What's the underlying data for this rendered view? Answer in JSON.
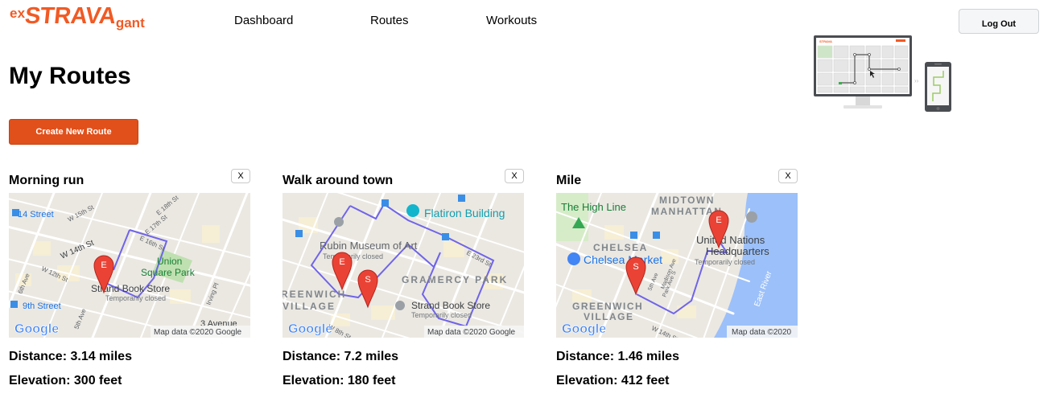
{
  "brand": {
    "ex": "ex",
    "strava": "STRAVA",
    "gant": "gant",
    "color": "#f15a24"
  },
  "nav": {
    "dashboard": "Dashboard",
    "routes": "Routes",
    "workouts": "Workouts"
  },
  "logout_label": "Log Out",
  "page_title": "My Routes",
  "create_button": "Create New Route",
  "illustration": {
    "screen_brand": "STRAVA"
  },
  "route_color": "#6f64e8",
  "marker_color": "#ea4335",
  "routes": [
    {
      "name": "Morning run",
      "close_label": "X",
      "distance": "Distance: 3.14 miles",
      "elevation": "Elevation: 300 feet",
      "map": {
        "labels": [
          "14 Street",
          "W 15th St",
          "W 14th St",
          "E 18th St",
          "E 17th St",
          "E 16th St",
          "Union",
          "Square Park",
          "Strand Book Store",
          "Temporarily closed",
          "9th Street",
          "6th Ave",
          "W 12th St",
          "5th Ave",
          "Irving Pl",
          "3 Avenue"
        ],
        "markers": [
          "E"
        ],
        "google": "Google",
        "attribution": "Map data ©2020 Google"
      }
    },
    {
      "name": "Walk around town",
      "close_label": "X",
      "distance": "Distance: 7.2 miles",
      "elevation": "Elevation: 180 feet",
      "map": {
        "labels": [
          "Flatiron Building",
          "Rubin Museum of Art",
          "Temporarily closed",
          "GRAMERCY PARK",
          "REENWICH",
          "VILLAGE",
          "Strand Book Store",
          "Temporarily closed",
          "E 23rd St",
          "W 8th St"
        ],
        "markers": [
          "E",
          "S"
        ],
        "google": "Google",
        "attribution": "Map data ©2020 Google"
      }
    },
    {
      "name": "Mile",
      "close_label": "X",
      "distance": "Distance: 1.46 miles",
      "elevation": "Elevation: 412 feet",
      "map": {
        "labels": [
          "MIDTOWN",
          "MANHATTAN",
          "The High Line",
          "CHELSEA",
          "Chelsea Market",
          "United Nations",
          "Headquarters",
          "Temporarily closed",
          "GREENWICH",
          "VILLAGE",
          "East River",
          "5th Ave",
          "Madison Ave",
          "Park Ave S",
          "W 14th St"
        ],
        "markers": [
          "E",
          "S"
        ],
        "google": "Google",
        "attribution": "Map data ©2020"
      }
    }
  ]
}
